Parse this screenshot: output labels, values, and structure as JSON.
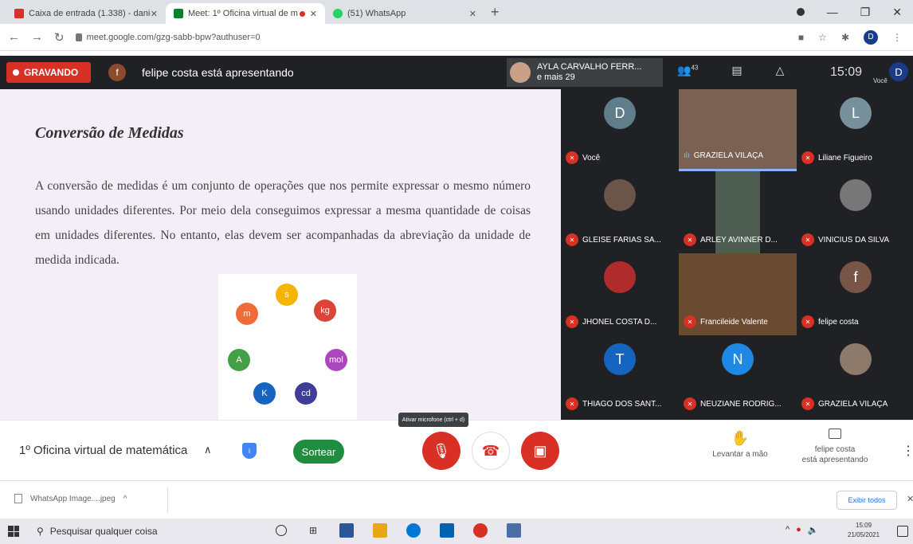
{
  "browser": {
    "tabs": [
      {
        "title": "Caixa de entrada (1.338) - danieli",
        "favicon_color": "#d93025"
      },
      {
        "title": "Meet: 1º Oficina virtual de m",
        "favicon_color": "#00832d"
      },
      {
        "title": "(51) WhatsApp",
        "favicon_color": "#25d366"
      }
    ],
    "new_tab": "+",
    "url": "meet.google.com/gzg-sabb-bpw?authuser=0",
    "profile_initial": "D"
  },
  "meet_top": {
    "recording_label": "GRAVANDO",
    "presenter_initial": "f",
    "presenting_text": "felipe costa está apresentando",
    "speaker_name": "AYLA CARVALHO FERR...",
    "speaker_more": "e mais 29",
    "participants_count": "43",
    "clock": "15:09",
    "you_label": "Você",
    "user_initial": "D"
  },
  "slide": {
    "title": "Conversão de Medidas",
    "body": "A conversão de medidas é um conjunto de operações que nos permite expressar o mesmo número usando unidades diferentes. Por meio dela conseguimos expressar a mesma quantidade de coisas em unidades diferentes. No entanto, elas devem ser acompanhadas da abreviação da unidade de medida indicada.",
    "units": [
      {
        "label": "s",
        "color": "#f4b400"
      },
      {
        "label": "kg",
        "color": "#db4437"
      },
      {
        "label": "mol",
        "color": "#ab47bc"
      },
      {
        "label": "cd",
        "color": "#3f3d99"
      },
      {
        "label": "K",
        "color": "#1565c0"
      },
      {
        "label": "A",
        "color": "#43a047"
      },
      {
        "label": "m",
        "color": "#ef6c38"
      }
    ]
  },
  "participants": [
    {
      "name": "Você",
      "initial": "D",
      "color": "#607d8b",
      "kind": "initial",
      "muted": true
    },
    {
      "name": "GRAZIELA VILAÇA",
      "initial": "",
      "color": "#7a6152",
      "kind": "video",
      "muted": false
    },
    {
      "name": "Liliane Figueiro",
      "initial": "L",
      "color": "#78909c",
      "kind": "initial",
      "muted": true
    },
    {
      "name": "GLEISE FARIAS SA...",
      "initial": "",
      "color": "#6b5448",
      "kind": "photo",
      "muted": true
    },
    {
      "name": "ARLEY AVINNER D...",
      "initial": "",
      "color": "#4e5d52",
      "kind": "video",
      "muted": true
    },
    {
      "name": "VINICIUS DA SILVA",
      "initial": "",
      "color": "#777777",
      "kind": "photo",
      "muted": true
    },
    {
      "name": "JHONEL COSTA D...",
      "initial": "",
      "color": "#b02c2c",
      "kind": "photo",
      "muted": true
    },
    {
      "name": "Francileide Valente",
      "initial": "",
      "color": "#6a4a30",
      "kind": "video",
      "muted": true
    },
    {
      "name": "felipe costa",
      "initial": "f",
      "color": "#795548",
      "kind": "initial",
      "muted": true
    },
    {
      "name": "THIAGO DOS SANT...",
      "initial": "T",
      "color": "#1565c0",
      "kind": "initial",
      "muted": true
    },
    {
      "name": "NEUZIANE RODRIG...",
      "initial": "N",
      "color": "#1e88e5",
      "kind": "initial",
      "muted": true
    },
    {
      "name": "GRAZIELA VILAÇA",
      "initial": "",
      "color": "#8d7a6a",
      "kind": "photo",
      "muted": true
    }
  ],
  "meet_bottom": {
    "meeting_name": "1º Oficina virtual de matemática",
    "sortear": "Sortear",
    "tooltip": "Ativar microfone (ctrl + d)",
    "raise_hand": "Levantar a mão",
    "presenting_line1": "felipe costa",
    "presenting_line2": "está apresentando"
  },
  "downloads": {
    "file": "WhatsApp Image....jpeg",
    "show_all": "Exibir todos"
  },
  "taskbar": {
    "search_placeholder": "Pesquisar qualquer coisa",
    "time": "15:09",
    "date": "21/05/2021",
    "icon_colors": [
      "#333333",
      "#333333",
      "#2b579a",
      "#e6a817",
      "#0078d4",
      "#0063b1",
      "#d93025",
      "#4a6fa5"
    ]
  }
}
